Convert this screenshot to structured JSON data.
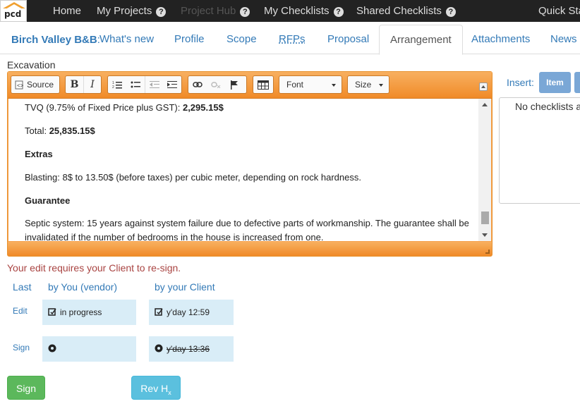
{
  "nav": {
    "logo_text": "pcd",
    "items": [
      {
        "label": "Home",
        "help": false,
        "disabled": false
      },
      {
        "label": "My Projects",
        "help": true,
        "disabled": false
      },
      {
        "label": "Project Hub",
        "help": true,
        "disabled": true
      },
      {
        "label": "My Checklists",
        "help": true,
        "disabled": false
      },
      {
        "label": "Shared Checklists",
        "help": true,
        "disabled": false
      },
      {
        "label": "Quick Sta",
        "help": false,
        "disabled": false
      }
    ]
  },
  "project": {
    "name": "Birch Valley B&B",
    "separator": ":",
    "tabs": [
      "What's new",
      "Profile",
      "Scope",
      "RFPs",
      "Proposal",
      "Arrangement",
      "Attachments",
      "News"
    ],
    "active_tab": "Arrangement"
  },
  "section_label": "Excavation",
  "toolbar": {
    "source_label": "Source",
    "font_label": "Font",
    "size_label": "Size"
  },
  "editor_content": {
    "tvq_prefix": "TVQ (9.75% of Fixed Price plus GST): ",
    "tvq_value": "2,295.15$",
    "total_prefix": "Total: ",
    "total_value": "25,835.15$",
    "extras_heading": "Extras",
    "blasting": "Blasting: 8$ to 13.50$ (before taxes) per cubic meter, depending on rock hardness.",
    "guarantee_heading": "Guarantee",
    "septic": "Septic system: 15 years against system failure due to defective parts of workmanship. The guarantee shall be invalidated if the number of bedrooms in the house is increased from one."
  },
  "insert": {
    "label": "Insert:",
    "item_button": "Item",
    "empty_text": "No checklists a"
  },
  "signing": {
    "warning": "Your edit requires your Client to re-sign.",
    "col_last": "Last",
    "col_vendor": "by You (vendor)",
    "col_client": "by your Client",
    "row_edit": "Edit",
    "row_sign": "Sign",
    "edit_vendor": "in progress",
    "edit_client": "y'day 12:59",
    "sign_vendor": "",
    "sign_client": "y'day 13:36"
  },
  "buttons": {
    "sign": "Sign",
    "rev_main": "Rev H",
    "rev_sub": "x"
  },
  "colors": {
    "navbar": "#222222",
    "link": "#337ab7",
    "editor_accent": "#f08a28",
    "warning": "#a94442",
    "cell_bg": "#d9edf7",
    "sign_button": "#5cb85c",
    "rev_button": "#5bc0de"
  }
}
